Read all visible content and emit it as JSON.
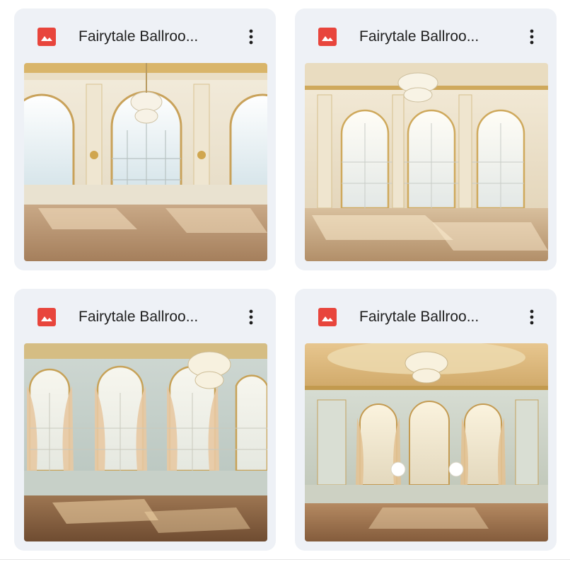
{
  "files": [
    {
      "title": "Fairytale Ballroo...",
      "icon": "image-file-icon",
      "menu_icon": "more-vert-icon",
      "icon_color": "#e8453c"
    },
    {
      "title": "Fairytale Ballroo...",
      "icon": "image-file-icon",
      "menu_icon": "more-vert-icon",
      "icon_color": "#e8453c"
    },
    {
      "title": "Fairytale Ballroo...",
      "icon": "image-file-icon",
      "menu_icon": "more-vert-icon",
      "icon_color": "#e8453c"
    },
    {
      "title": "Fairytale Ballroo...",
      "icon": "image-file-icon",
      "menu_icon": "more-vert-icon",
      "icon_color": "#e8453c"
    }
  ],
  "colors": {
    "card_background": "#eef1f6",
    "title_text": "#1f1f1f",
    "icon_red": "#e8453c"
  }
}
